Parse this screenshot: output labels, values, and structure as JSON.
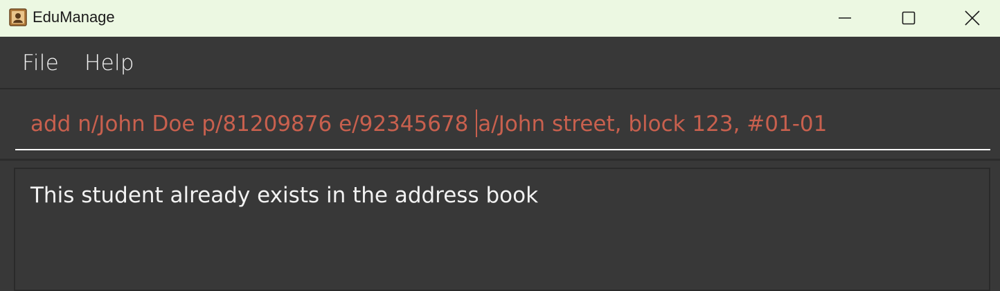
{
  "window": {
    "title": "EduManage",
    "app_icon": "address-book-icon",
    "controls": [
      "minimize-icon",
      "maximize-icon",
      "close-icon"
    ]
  },
  "menu": {
    "file": "File",
    "help": "Help"
  },
  "command": {
    "before_caret": "add n/John Doe p/81209876 e/92345678 ",
    "after_caret": "a/John street, block 123, #01-01",
    "text_color": "#c8604e"
  },
  "result": {
    "message": "This student already exists in the address book"
  },
  "colors": {
    "titlebar": "#ecf8e2",
    "background": "#383838",
    "error_text": "#c8604e"
  }
}
